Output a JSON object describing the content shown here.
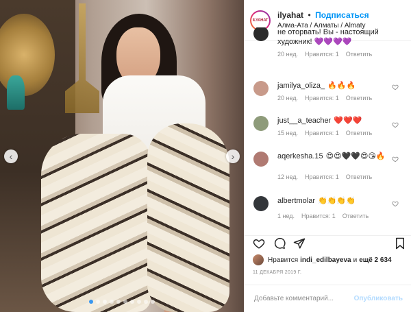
{
  "post": {
    "username": "ilyahat",
    "separator": "•",
    "follow_label": "Подписаться",
    "location": "Алма-Ата / Алматы / Almaty",
    "avatar_text": "ILYAHAT"
  },
  "comments": [
    {
      "username": "",
      "text": "не оторвать! Вы - настоящий художник! 💜💜💜💜",
      "time": "20 нед.",
      "likes": "Нравится: 1",
      "reply": "Ответить",
      "avatar_color": "#2b2b2b"
    },
    {
      "username": "jamilya_oliza_",
      "text": "🔥🔥🔥",
      "time": "20 нед.",
      "likes": "Нравится: 1",
      "reply": "Ответить",
      "avatar_color": "#c89a8a"
    },
    {
      "username": "just__a_teacher",
      "text": "❤️❤️❤️",
      "time": "15 нед.",
      "likes": "Нравится: 1",
      "reply": "Ответить",
      "avatar_color": "#8e9b7a"
    },
    {
      "username": "aqerkesha.15",
      "text": "😍😍🖤🖤😍😘🔥",
      "time": "12 нед.",
      "likes": "Нравится: 1",
      "reply": "Ответить",
      "avatar_color": "#b07a72"
    },
    {
      "username": "albertmolar",
      "text": "👏👏👏👏",
      "time": "1 нед.",
      "likes": "Нравится: 1",
      "reply": "Ответить",
      "avatar_color": "#33363a"
    }
  ],
  "likes": {
    "prefix": "Нравится",
    "user": "indi_edilbayeva",
    "middle": "и",
    "count": "ещё 2 634"
  },
  "date": "11 ДЕКАБРЯ 2019 Г.",
  "add_comment": {
    "placeholder": "Добавьте комментарий...",
    "publish_label": "Опубликовать"
  },
  "carousel": {
    "count": 10,
    "active_index": 0
  },
  "colors": {
    "accent": "#0095f6",
    "muted": "#8e8e8e",
    "publish_disabled": "#b3dbff"
  }
}
